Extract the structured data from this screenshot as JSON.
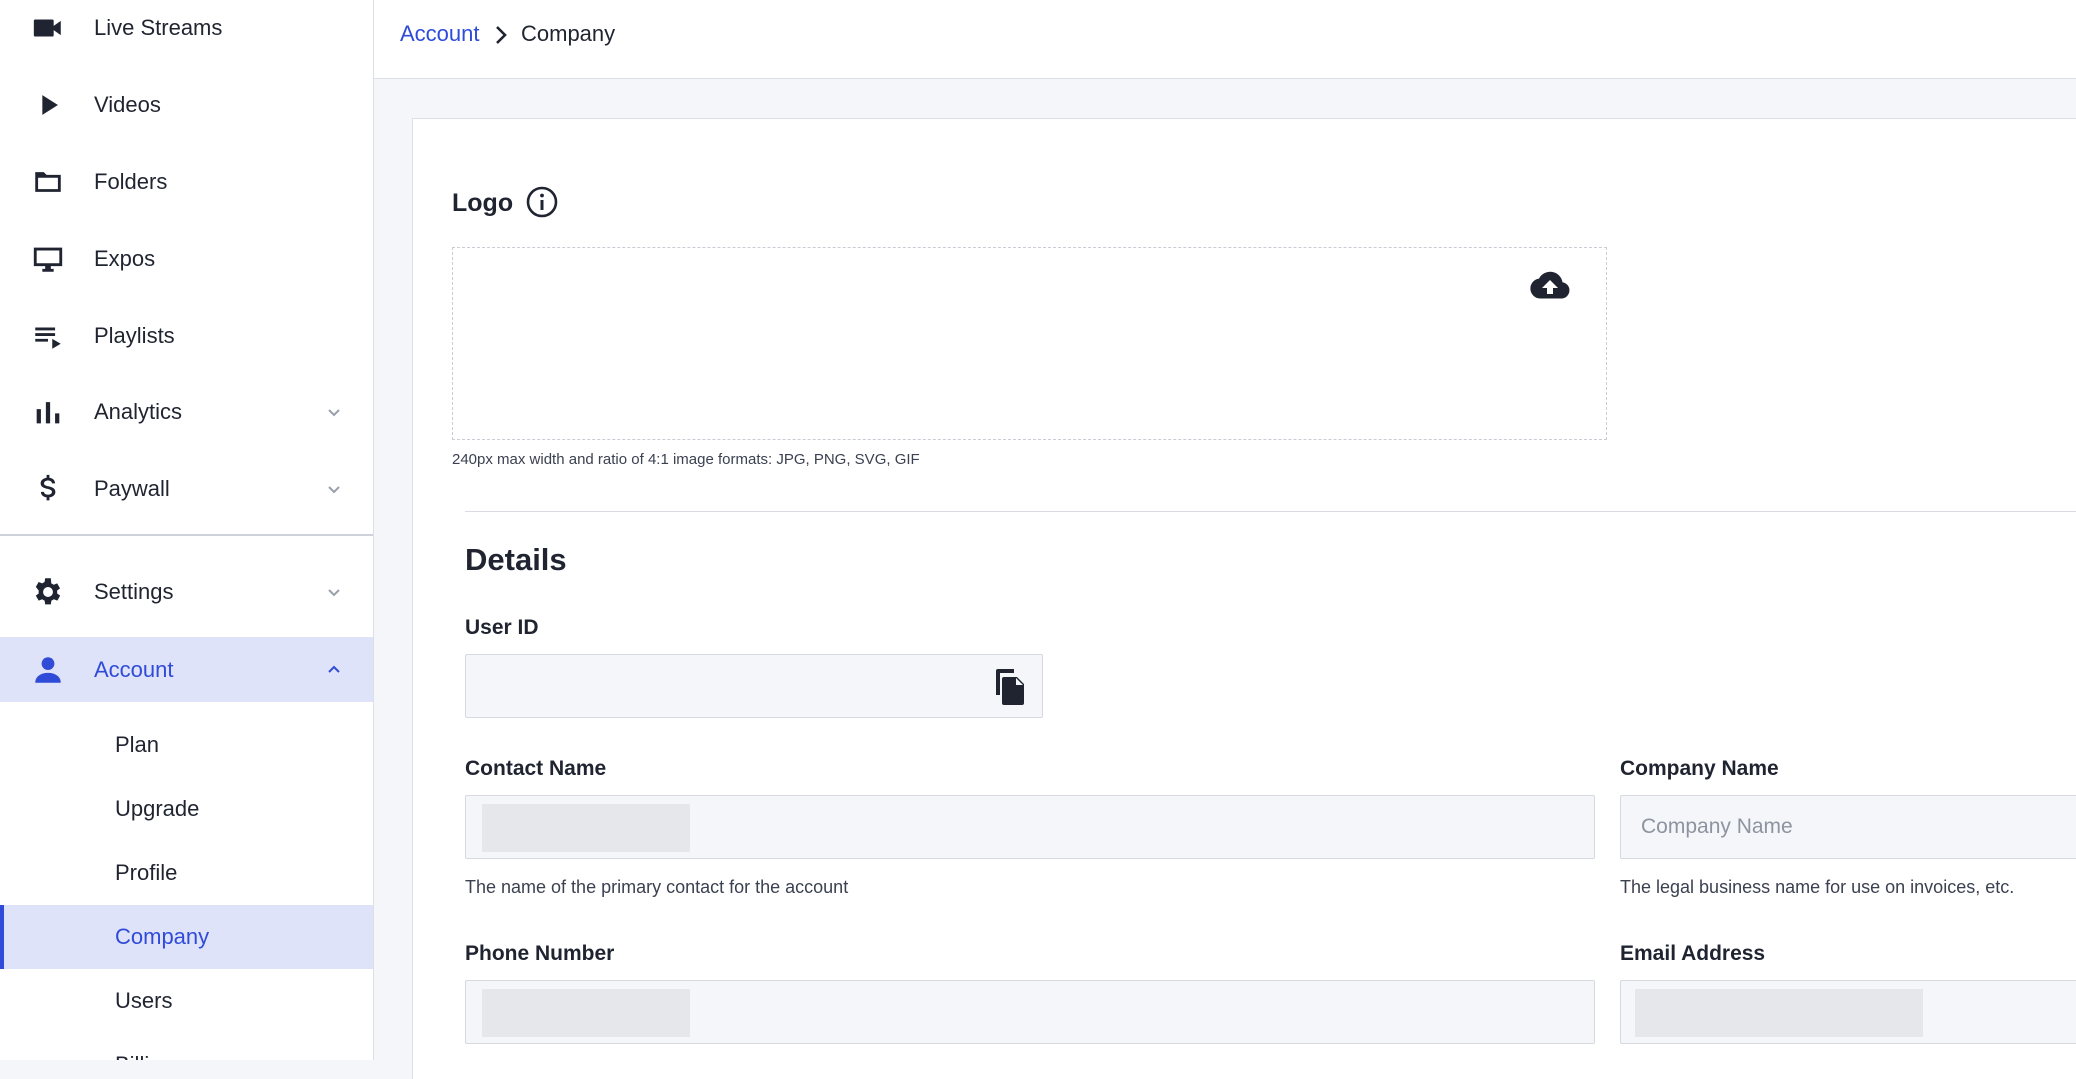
{
  "sidebar": {
    "items": [
      {
        "label": "Live Streams",
        "icon": "video-camera-icon"
      },
      {
        "label": "Videos",
        "icon": "play-icon"
      },
      {
        "label": "Folders",
        "icon": "folder-icon"
      },
      {
        "label": "Expos",
        "icon": "monitor-icon"
      },
      {
        "label": "Playlists",
        "icon": "playlist-icon"
      },
      {
        "label": "Analytics",
        "icon": "bar-chart-icon"
      },
      {
        "label": "Paywall",
        "icon": "dollar-icon"
      },
      {
        "label": "Settings",
        "icon": "gear-icon"
      },
      {
        "label": "Account",
        "icon": "person-icon"
      }
    ],
    "account_sub": [
      {
        "label": "Plan"
      },
      {
        "label": "Upgrade"
      },
      {
        "label": "Profile"
      },
      {
        "label": "Company"
      },
      {
        "label": "Users"
      },
      {
        "label": "Billing"
      }
    ]
  },
  "breadcrumb": {
    "parent": "Account",
    "current": "Company"
  },
  "logo": {
    "title": "Logo",
    "hint": "240px max width and ratio of 4:1 image formats: JPG, PNG, SVG, GIF"
  },
  "details": {
    "title": "Details",
    "user_id": {
      "label": "User ID",
      "value": ""
    },
    "contact_name": {
      "label": "Contact Name",
      "value": "",
      "helper": "The name of the primary contact for the account"
    },
    "company_name": {
      "label": "Company Name",
      "placeholder": "Company Name",
      "value": "",
      "helper": "The legal business name for use on invoices, etc."
    },
    "phone_number": {
      "label": "Phone Number",
      "value": ""
    },
    "email_address": {
      "label": "Email Address",
      "value": ""
    }
  },
  "colors": {
    "accent": "#2f4bd8",
    "active_bg": "#dfe3fa",
    "text": "#1f2430"
  }
}
